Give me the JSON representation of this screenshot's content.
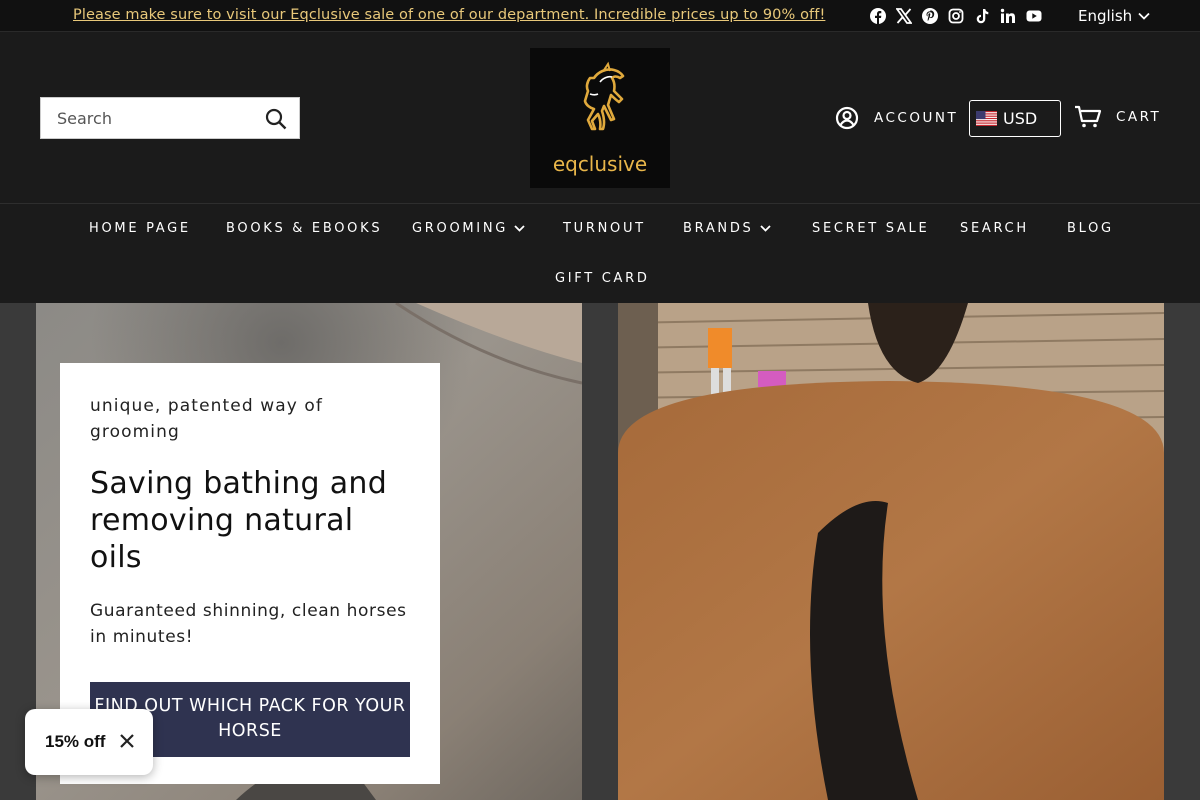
{
  "announcement": {
    "text": "Please make sure to visit our Eqclusive sale of one of our department. Incredible prices up to 90% off!"
  },
  "social_icons": [
    "facebook-icon",
    "x-icon",
    "pinterest-icon",
    "instagram-icon",
    "tiktok-icon",
    "linkedin-icon",
    "youtube-icon"
  ],
  "language": {
    "selected": "English"
  },
  "header": {
    "search_placeholder": "Search",
    "logo_text": "eqclusive",
    "account_label": "ACCOUNT",
    "currency": "USD",
    "cart_label": "CART"
  },
  "nav": {
    "items": [
      {
        "label": "HOME PAGE"
      },
      {
        "label": "BOOKS & EBOOKS"
      },
      {
        "label": "GROOMING"
      },
      {
        "label": "TURNOUT"
      },
      {
        "label": "BRANDS"
      },
      {
        "label": "SECRET SALE"
      },
      {
        "label": "SEARCH"
      },
      {
        "label": "BLOG"
      },
      {
        "label": "GIFT CARD"
      }
    ]
  },
  "hero": {
    "eyebrow": "unique, patented way of grooming",
    "title": "Saving bathing and removing natural oils",
    "subtitle": "Guaranteed shinning, clean horses in minutes!",
    "button_label": "FIND OUT WHICH PACK FOR YOUR HORSE"
  },
  "discount_popup": {
    "label": "15% off"
  },
  "colors": {
    "background": "#1b1b1b",
    "announcement_text": "#e8c87a",
    "logo_gold": "#e8b64a",
    "button": "#2f3350"
  }
}
